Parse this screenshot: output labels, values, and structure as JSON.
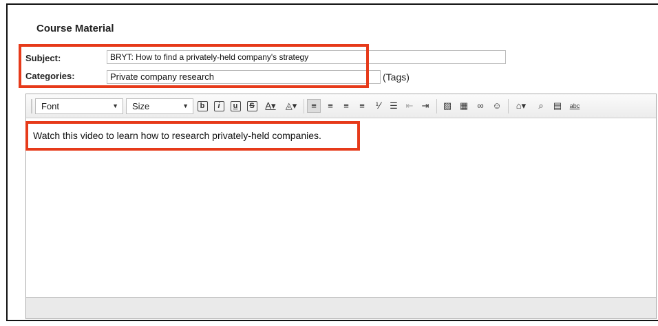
{
  "title": "Course Material",
  "subject": {
    "label": "Subject:",
    "value": "BRYT: How to find a privately-held company's strategy"
  },
  "categories": {
    "label": "Categories:",
    "value": "Private company research",
    "suffix": "(Tags)"
  },
  "toolbar": {
    "font_label": "Font",
    "size_label": "Size",
    "bold_glyph": "b",
    "italic_glyph": "i",
    "underline_glyph": "u",
    "strike_glyph": "S",
    "font_color_glyph": "A▾",
    "bg_color_glyph": "◬▾",
    "align_left_glyph": "≡",
    "align_center_glyph": "≡",
    "align_right_glyph": "≡",
    "justify_glyph": "≡",
    "ordered_list_glyph": "⅟",
    "unordered_list_glyph": "☰",
    "outdent_glyph": "⇤",
    "indent_glyph": "⇥",
    "image_glyph": "▨",
    "table_glyph": "▦",
    "link_glyph": "∞",
    "emoticon_glyph": "☺",
    "template_glyph": "⌂▾",
    "find_glyph": "⌕",
    "source_glyph": "▤",
    "spellcheck_glyph": "abc"
  },
  "editor": {
    "content": "Watch this video to learn how to research privately-held companies."
  },
  "colors": {
    "highlight": "#e63a1a"
  }
}
